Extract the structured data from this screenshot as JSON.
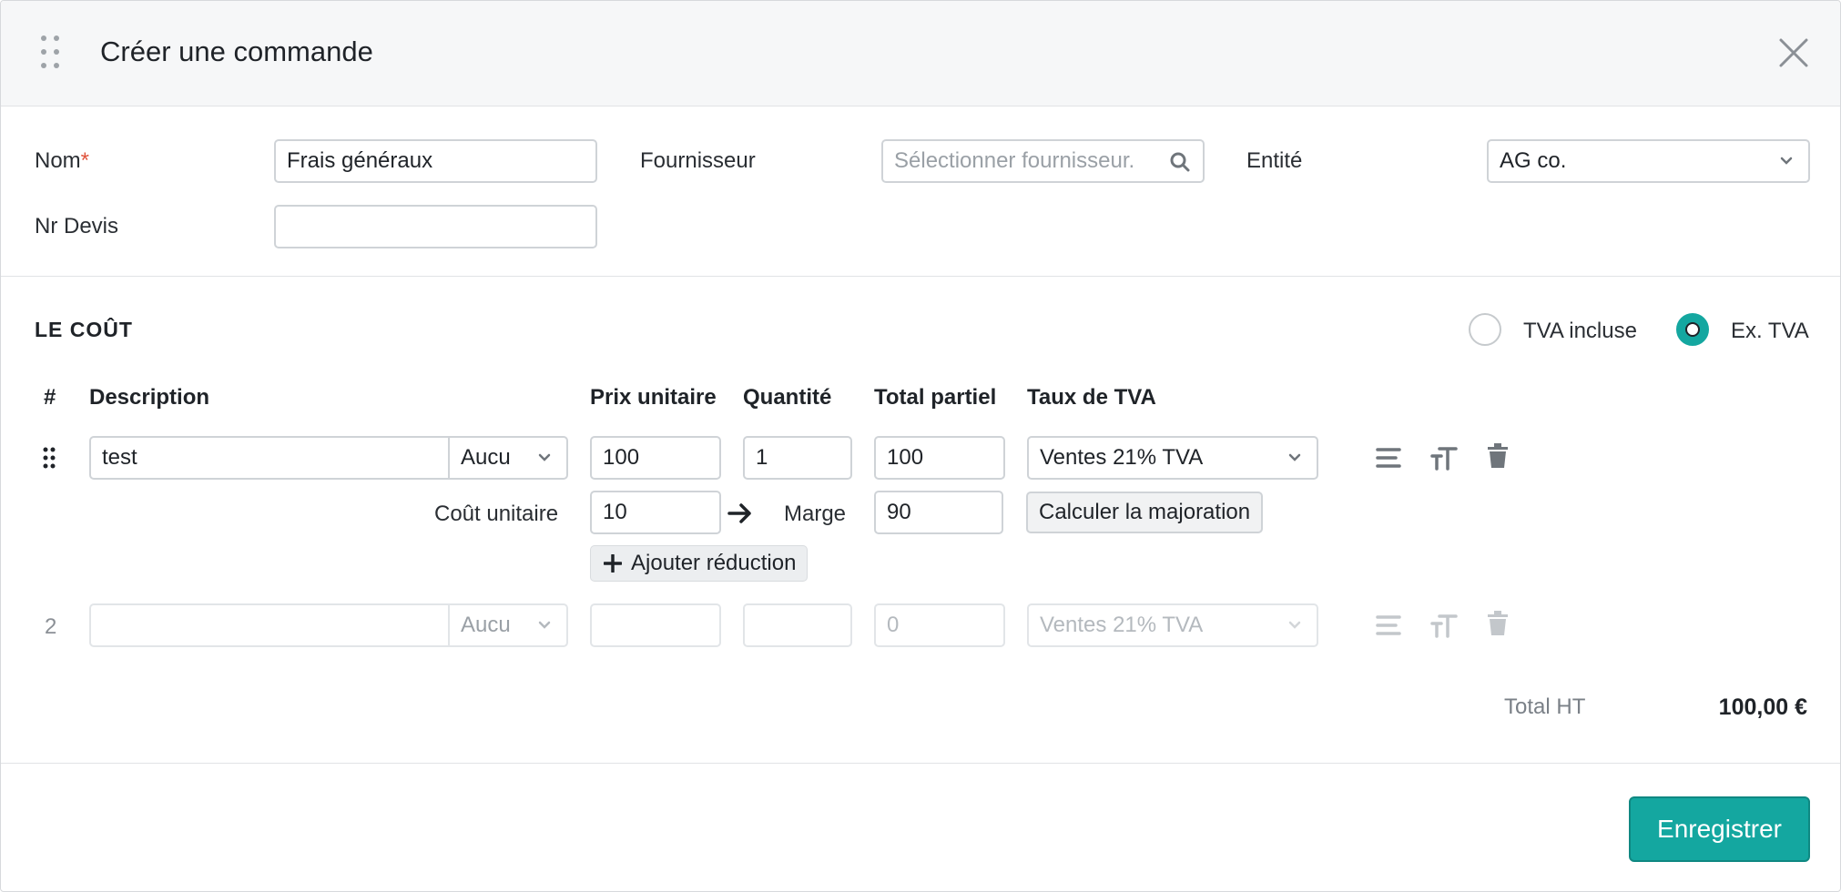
{
  "dialog": {
    "title": "Créer une commande",
    "close_icon": "close-icon"
  },
  "form": {
    "name_label": "Nom",
    "name_required": "*",
    "name_value": "Frais généraux",
    "supplier_label": "Fournisseur",
    "supplier_placeholder": "Sélectionner fournisseur.",
    "entity_label": "Entité",
    "entity_value": "AG co.",
    "quote_label": "Nr Devis",
    "quote_value": ""
  },
  "cost": {
    "section_title": "LE COÛT",
    "tax_options": [
      {
        "label": "TVA incluse",
        "selected": false
      },
      {
        "label": "Ex. TVA",
        "selected": true
      }
    ],
    "columns": {
      "num": "#",
      "description": "Description",
      "unit_price": "Prix unitaire",
      "quantity": "Quantité",
      "subtotal": "Total partiel",
      "vat_rate": "Taux de TVA"
    },
    "rows": [
      {
        "num": "",
        "description": "test",
        "unit": "Aucu",
        "unit_price": "100",
        "quantity": "1",
        "subtotal": "100",
        "vat": "Ventes 21% TVA"
      },
      {
        "num": "2",
        "description": "",
        "unit": "Aucu",
        "unit_price": "",
        "quantity": "",
        "subtotal": "0",
        "vat": "Ventes 21% TVA"
      }
    ],
    "unit_cost_label": "Coût unitaire",
    "unit_cost_value": "10",
    "margin_label": "Marge",
    "margin_value": "90",
    "calc_markup_label": "Calculer la majoration",
    "add_discount_label": "Ajouter réduction",
    "total_label": "Total HT",
    "total_value": "100,00 €"
  },
  "footer": {
    "save_label": "Enregistrer"
  },
  "colors": {
    "accent": "#14a7a0",
    "required": "#e0533c"
  }
}
